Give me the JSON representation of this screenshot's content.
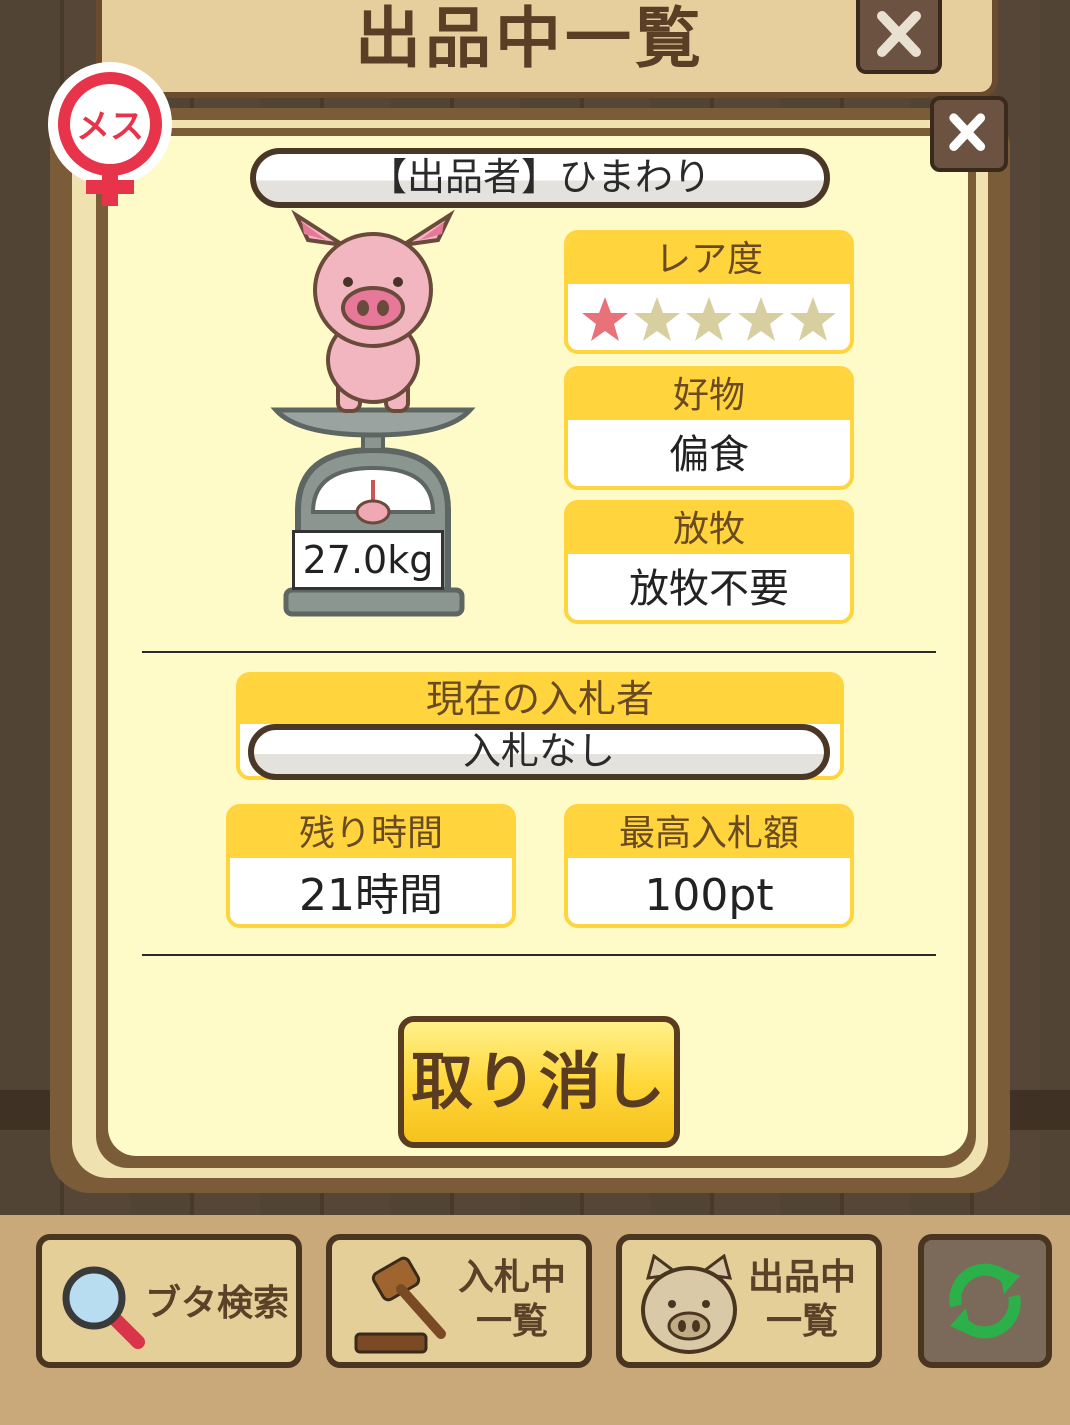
{
  "header": {
    "title": "出品中一覧"
  },
  "badge": {
    "gender": "メス"
  },
  "seller": {
    "label": "【出品者】ひまわり"
  },
  "pig": {
    "weight": "27.0kg"
  },
  "rarity": {
    "label": "レア度",
    "rating": 1,
    "max": 5
  },
  "favorite": {
    "label": "好物",
    "value": "偏食"
  },
  "grazing": {
    "label": "放牧",
    "value": "放牧不要"
  },
  "bidder": {
    "label": "現在の入札者",
    "value": "入札なし"
  },
  "time_left": {
    "label": "残り時間",
    "value": "21時間"
  },
  "max_bid": {
    "label": "最高入札額",
    "value": "100pt"
  },
  "cancel": {
    "label": "取り消し"
  },
  "toolbar": {
    "search_label": "ブタ検索",
    "bidding_label_1": "入札中",
    "bidding_label_2": "一覧",
    "listing_label_1": "出品中",
    "listing_label_2": "一覧"
  },
  "colors": {
    "accent": "#ffd43c",
    "star_on": "#e8717a",
    "star_off": "#d8cfa0"
  }
}
